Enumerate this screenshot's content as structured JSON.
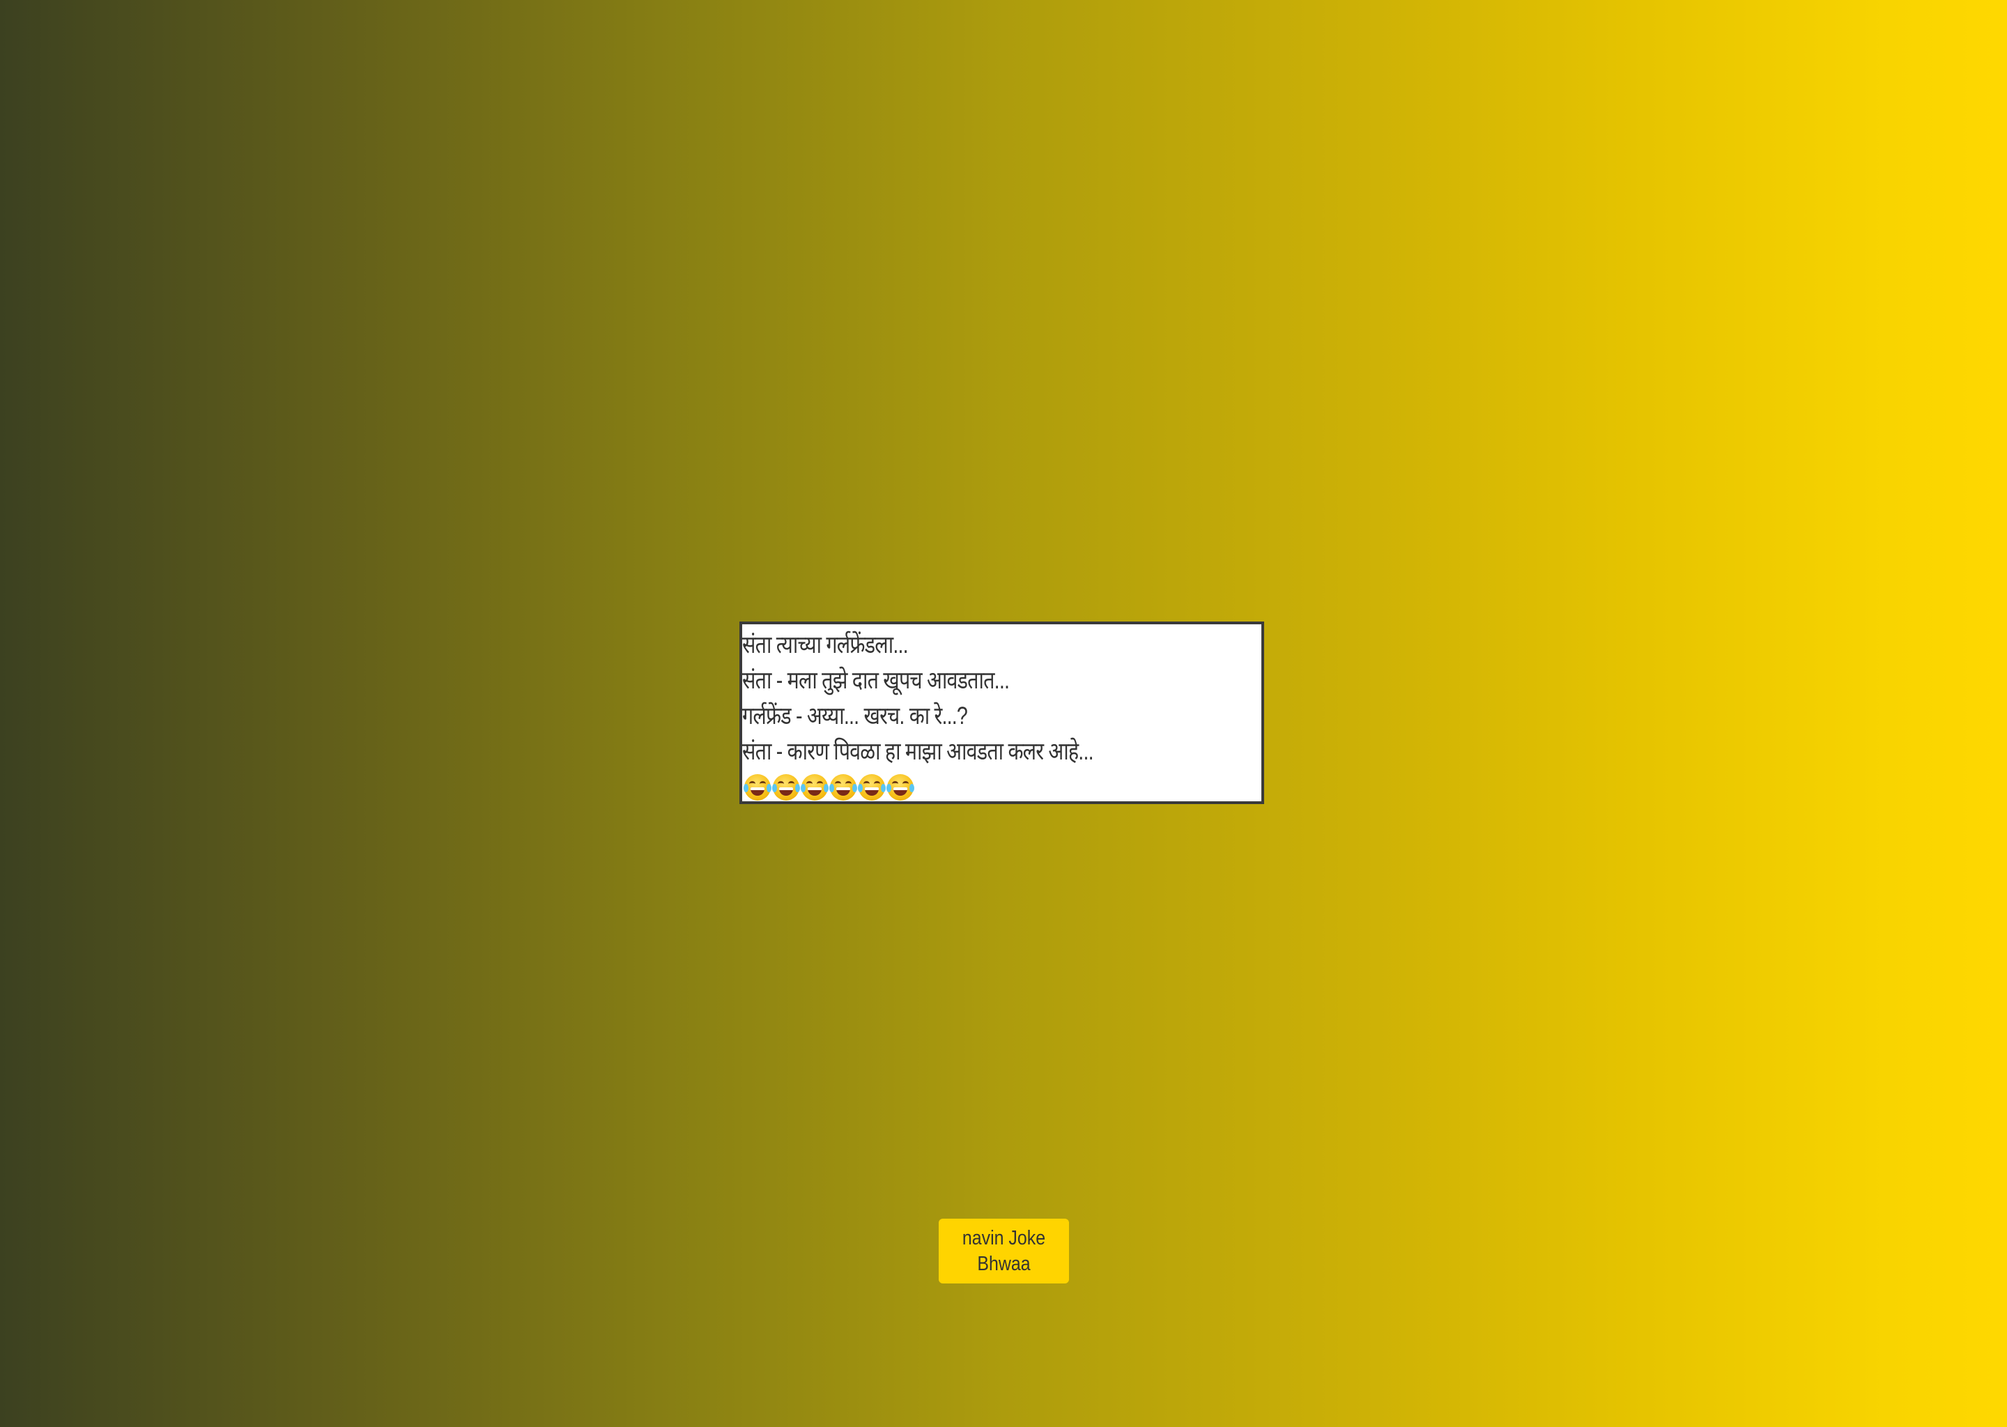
{
  "joke": {
    "lines": [
      "संता त्याच्या गर्लफ्रेंडला...",
      "संता - मला तुझे दात खूपच आवडतात...",
      "गर्लफ्रेंड - अय्या... खरच. का रे...?",
      "संता - कारण पिवळा हा माझा आवडता कलर आहे..."
    ],
    "emoji": [
      "face-with-tears-of-joy",
      "face-with-tears-of-joy",
      "face-with-tears-of-joy",
      "face-with-tears-of-joy",
      "face-with-tears-of-joy",
      "face-with-tears-of-joy"
    ]
  },
  "button": {
    "label": "navin Joke Bhwaa"
  },
  "colors": {
    "gradient_start": "#3c4120",
    "gradient_end": "#ffd800",
    "button_bg": "#ffd400",
    "box_border": "#3a3a3a",
    "text": "#333333"
  }
}
